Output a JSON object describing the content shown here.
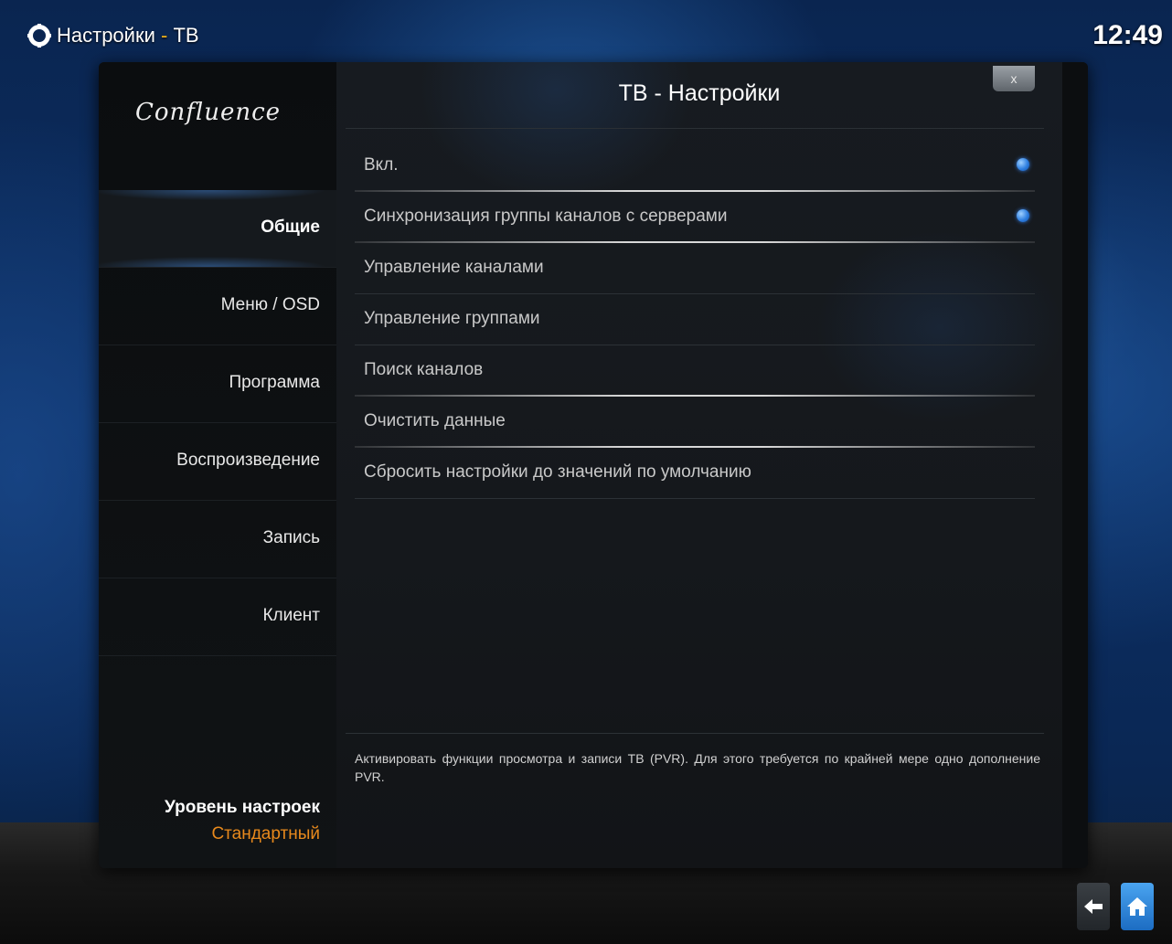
{
  "header": {
    "title_main": "Настройки",
    "title_sep": " - ",
    "title_sub": "ТВ",
    "clock": "12:49"
  },
  "icons": {
    "settings": "gear-icon",
    "back": "back-arrow-icon",
    "home": "home-icon"
  },
  "sidebar": {
    "logo": "Confluence",
    "categories": [
      {
        "label": "Общие",
        "active": true
      },
      {
        "label": "Меню / OSD",
        "active": false
      },
      {
        "label": "Программа",
        "active": false
      },
      {
        "label": "Воспроизведение",
        "active": false
      },
      {
        "label": "Запись",
        "active": false
      },
      {
        "label": "Клиент",
        "active": false
      }
    ],
    "level_label": "Уровень настроек",
    "level_value": "Стандартный"
  },
  "dialog": {
    "title": "ТВ - Настройки",
    "close_label": "x",
    "settings": [
      {
        "label": "Вкл.",
        "toggle": true
      },
      {
        "label": "Синхронизация группы каналов с серверами",
        "toggle": true
      },
      {
        "label": "Управление каналами"
      },
      {
        "label": "Управление группами"
      },
      {
        "label": "Поиск каналов"
      },
      {
        "label": "Очистить данные"
      },
      {
        "label": "Сбросить настройки до значений по умолчанию"
      }
    ],
    "description": "Активировать функции просмотра и записи ТВ (PVR). Для этого требуется по крайней мере одно дополнение PVR."
  },
  "colors": {
    "accent_orange": "#e8891c",
    "title_sep_color": "#f0b21a",
    "toggle_blue": "#2f7fe0",
    "home_blue": "#1c6cc2"
  }
}
